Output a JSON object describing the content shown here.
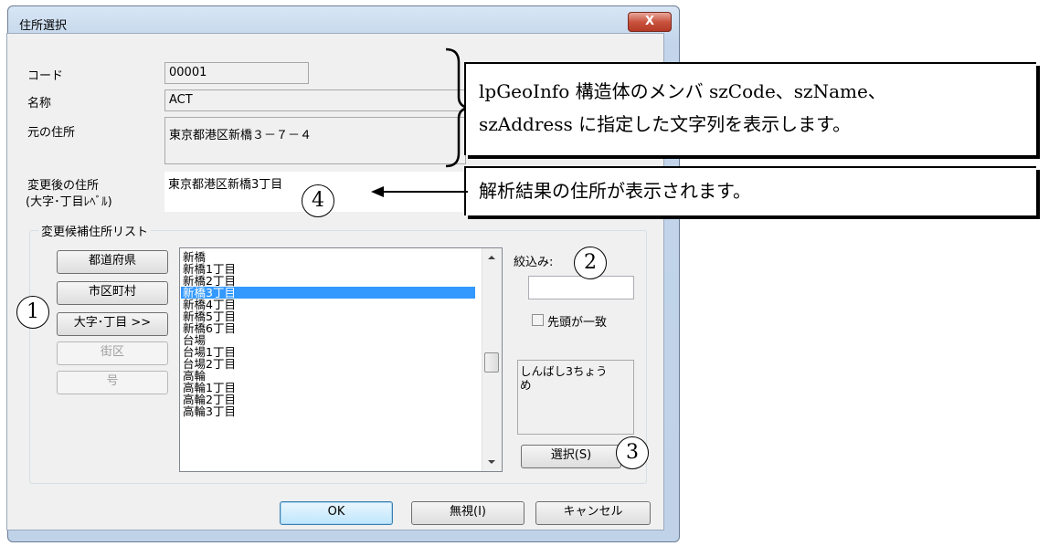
{
  "window": {
    "title": "住所選択",
    "close_label": "X"
  },
  "fields": {
    "code_label": "コード",
    "code_value": "00001",
    "name_label": "名称",
    "name_value": "ACT",
    "orig_label": "元の住所",
    "orig_value": "東京都港区新橋３－７－４",
    "changed_label_1": "変更後の住所",
    "changed_label_2": "(大字･丁目ﾚﾍﾞﾙ)",
    "changed_value": "東京都港区新橋3丁目"
  },
  "group": {
    "title": "変更候補住所リスト"
  },
  "level_buttons": [
    "都道府県",
    "市区町村",
    "大字･丁目 >>",
    "街区",
    "号"
  ],
  "list_items": [
    "新橋",
    "新橋1丁目",
    "新橋2丁目",
    "新橋3丁目",
    "新橋4丁目",
    "新橋5丁目",
    "新橋6丁目",
    "台場",
    "台場1丁目",
    "台場2丁目",
    "高輪",
    "高輪1丁目",
    "高輪2丁目",
    "高輪3丁目"
  ],
  "selected_item": "新橋3丁目",
  "filter": {
    "label": "絞込み:",
    "value": "",
    "checkbox_label": "先頭が一致",
    "checked": false
  },
  "reading": {
    "line1": "しんばし3ちょう",
    "line2": "め"
  },
  "select_button": "選択(S)",
  "footer": {
    "ok": "OK",
    "ignore": "無視(I)",
    "cancel": "キャンセル"
  },
  "callouts": {
    "c1_line1": "lpGeoInfo 構造体のメンバ szCode、szName、",
    "c1_line2": "szAddress に指定した文字列を表示します。",
    "c2": "解析結果の住所が表示されます。"
  },
  "markers": [
    "1",
    "2",
    "3",
    "4"
  ]
}
